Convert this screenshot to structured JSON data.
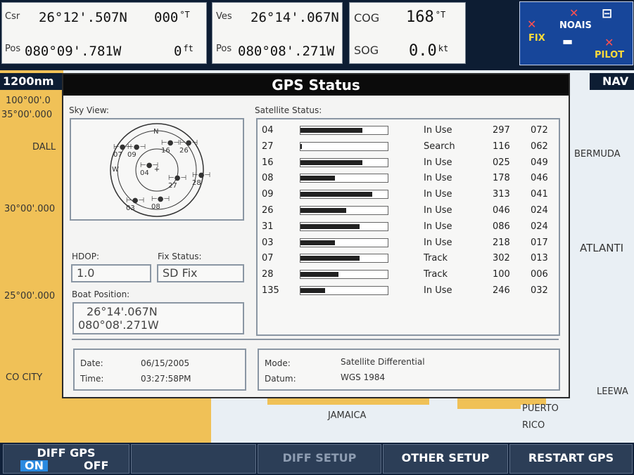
{
  "header": {
    "csr_label": "Csr",
    "csr_lat": "26°12'.507N",
    "csr_heading": "000",
    "csr_heading_unit": "°T",
    "pos_label": "Pos",
    "csr_lon": "080°09'.781W",
    "csr_depth": "0",
    "csr_depth_unit": "ft",
    "ves_label": "Ves",
    "ves_lat": "26°14'.067N",
    "ves_pos_label": "Pos",
    "ves_lon": "080°08'.271W",
    "cog_label": "COG",
    "cog_value": "168",
    "cog_unit": "°T",
    "sog_label": "SOG",
    "sog_value": "0.0",
    "sog_unit": "kt"
  },
  "status_icons": {
    "noais": "NOAIS",
    "fix": "FIX",
    "pilot": "PILOT"
  },
  "map": {
    "scale": "1200nm",
    "mode": "NAV",
    "labels": {
      "lat100": "100°00'.0",
      "lat35": "35°00'.000",
      "dall": "DALL",
      "lat30": "30°00'.000",
      "lat25": "25°00'.000",
      "cocity": "CO CITY",
      "bermuda": "BERMUDA",
      "atlanti": "ATLANTI",
      "leewa": "LEEWA",
      "jamaica": "JAMAICA",
      "puerto": "PUERTO",
      "rico": "RICO"
    }
  },
  "dialog": {
    "title": "GPS Status",
    "sky_view_label": "Sky View:",
    "satellite_status_label": "Satellite Status:",
    "hdop_label": "HDOP:",
    "hdop_value": "1.0",
    "fix_status_label": "Fix Status:",
    "fix_status_value": "SD Fix",
    "boat_position_label": "Boat Position:",
    "boat_lat": "26°14'.067N",
    "boat_lon": "080°08'.271W",
    "date_label": "Date:",
    "date_value": "06/15/2005",
    "time_label": "Time:",
    "time_value": "03:27:58PM",
    "mode_label": "Mode:",
    "mode_value": "Satellite Differential",
    "datum_label": "Datum:",
    "datum_value": "WGS 1984",
    "sky_labels": {
      "n": "N",
      "w": "W",
      "s07": "07",
      "s09": "09",
      "s16": "16",
      "s26": "26",
      "s04": "04",
      "s27": "27",
      "s28": "28",
      "s03": "03",
      "s08": "08"
    },
    "satellites": [
      {
        "prn": "04",
        "signal": 0.72,
        "status": "In Use",
        "elev": "297",
        "azim": "072"
      },
      {
        "prn": "27",
        "signal": 0.02,
        "status": "Search",
        "elev": "116",
        "azim": "062"
      },
      {
        "prn": "16",
        "signal": 0.72,
        "status": "In Use",
        "elev": "025",
        "azim": "049"
      },
      {
        "prn": "08",
        "signal": 0.4,
        "status": "In Use",
        "elev": "178",
        "azim": "046"
      },
      {
        "prn": "09",
        "signal": 0.84,
        "status": "In Use",
        "elev": "313",
        "azim": "041"
      },
      {
        "prn": "26",
        "signal": 0.53,
        "status": "In Use",
        "elev": "046",
        "azim": "024"
      },
      {
        "prn": "31",
        "signal": 0.69,
        "status": "In Use",
        "elev": "086",
        "azim": "024"
      },
      {
        "prn": "03",
        "signal": 0.4,
        "status": "In Use",
        "elev": "218",
        "azim": "017"
      },
      {
        "prn": "07",
        "signal": 0.69,
        "status": "Track",
        "elev": "302",
        "azim": "013"
      },
      {
        "prn": "28",
        "signal": 0.44,
        "status": "Track",
        "elev": "100",
        "azim": "006"
      },
      {
        "prn": "135",
        "signal": 0.29,
        "status": "In Use",
        "elev": "246",
        "azim": "032"
      }
    ]
  },
  "softkeys": {
    "diff_gps": "DIFF GPS",
    "on": "ON",
    "off": "OFF",
    "diff_setup": "DIFF SETUP",
    "other_setup": "OTHER SETUP",
    "restart_gps": "RESTART GPS"
  }
}
